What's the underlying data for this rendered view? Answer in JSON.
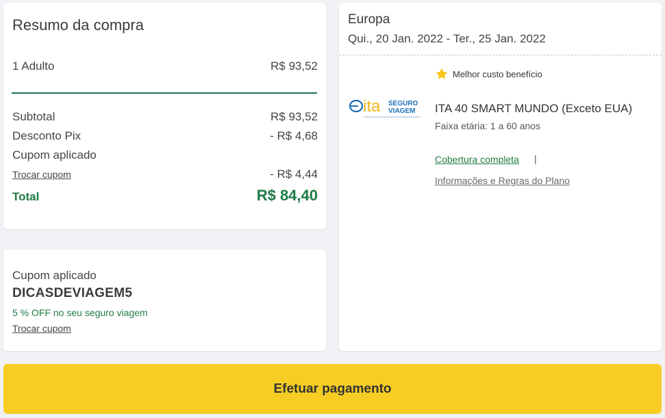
{
  "summary": {
    "title": "Resumo da compra",
    "adult_label": "1 Adulto",
    "adult_value": "R$ 93,52",
    "subtotal_label": "Subtotal",
    "subtotal_value": "R$ 93,52",
    "pix_label": "Desconto Pix",
    "pix_value": "- R$ 4,68",
    "coupon_label": "Cupom aplicado",
    "change_coupon": "Trocar cupom",
    "coupon_value": "- R$ 4,44",
    "total_label": "Total",
    "total_value": "R$ 84,40"
  },
  "coupon": {
    "label": "Cupom aplicado",
    "code": "DICASDEVIAGEM5",
    "discount": "5 % OFF no seu seguro viagem",
    "change": "Trocar cupom"
  },
  "plan": {
    "destination": "Europa",
    "dates": "Qui., 20 Jan. 2022 - Ter., 25 Jan. 2022",
    "badge": "Melhor custo benefício",
    "logo_main": "ita",
    "logo_line1": "SEGURO",
    "logo_line2": "VIAGEM",
    "name": "ITA 40 SMART MUNDO (Exceto EUA)",
    "age_range": "Faixa etária: 1 a 60 anos",
    "coverage_link": "Cobertura completa",
    "separator": "|",
    "rules_link": "Informações e Regras do Plano"
  },
  "actions": {
    "pay": "Efetuar pagamento"
  },
  "colors": {
    "accent_green": "#1f7a44",
    "button_yellow": "#f7cd24",
    "star_yellow": "#f5c518",
    "logo_blue": "#1d6fb8",
    "logo_yellow": "#f2b51b"
  },
  "icons": {
    "badge": "star-icon",
    "logo": "ita-seguro-viagem-logo"
  }
}
